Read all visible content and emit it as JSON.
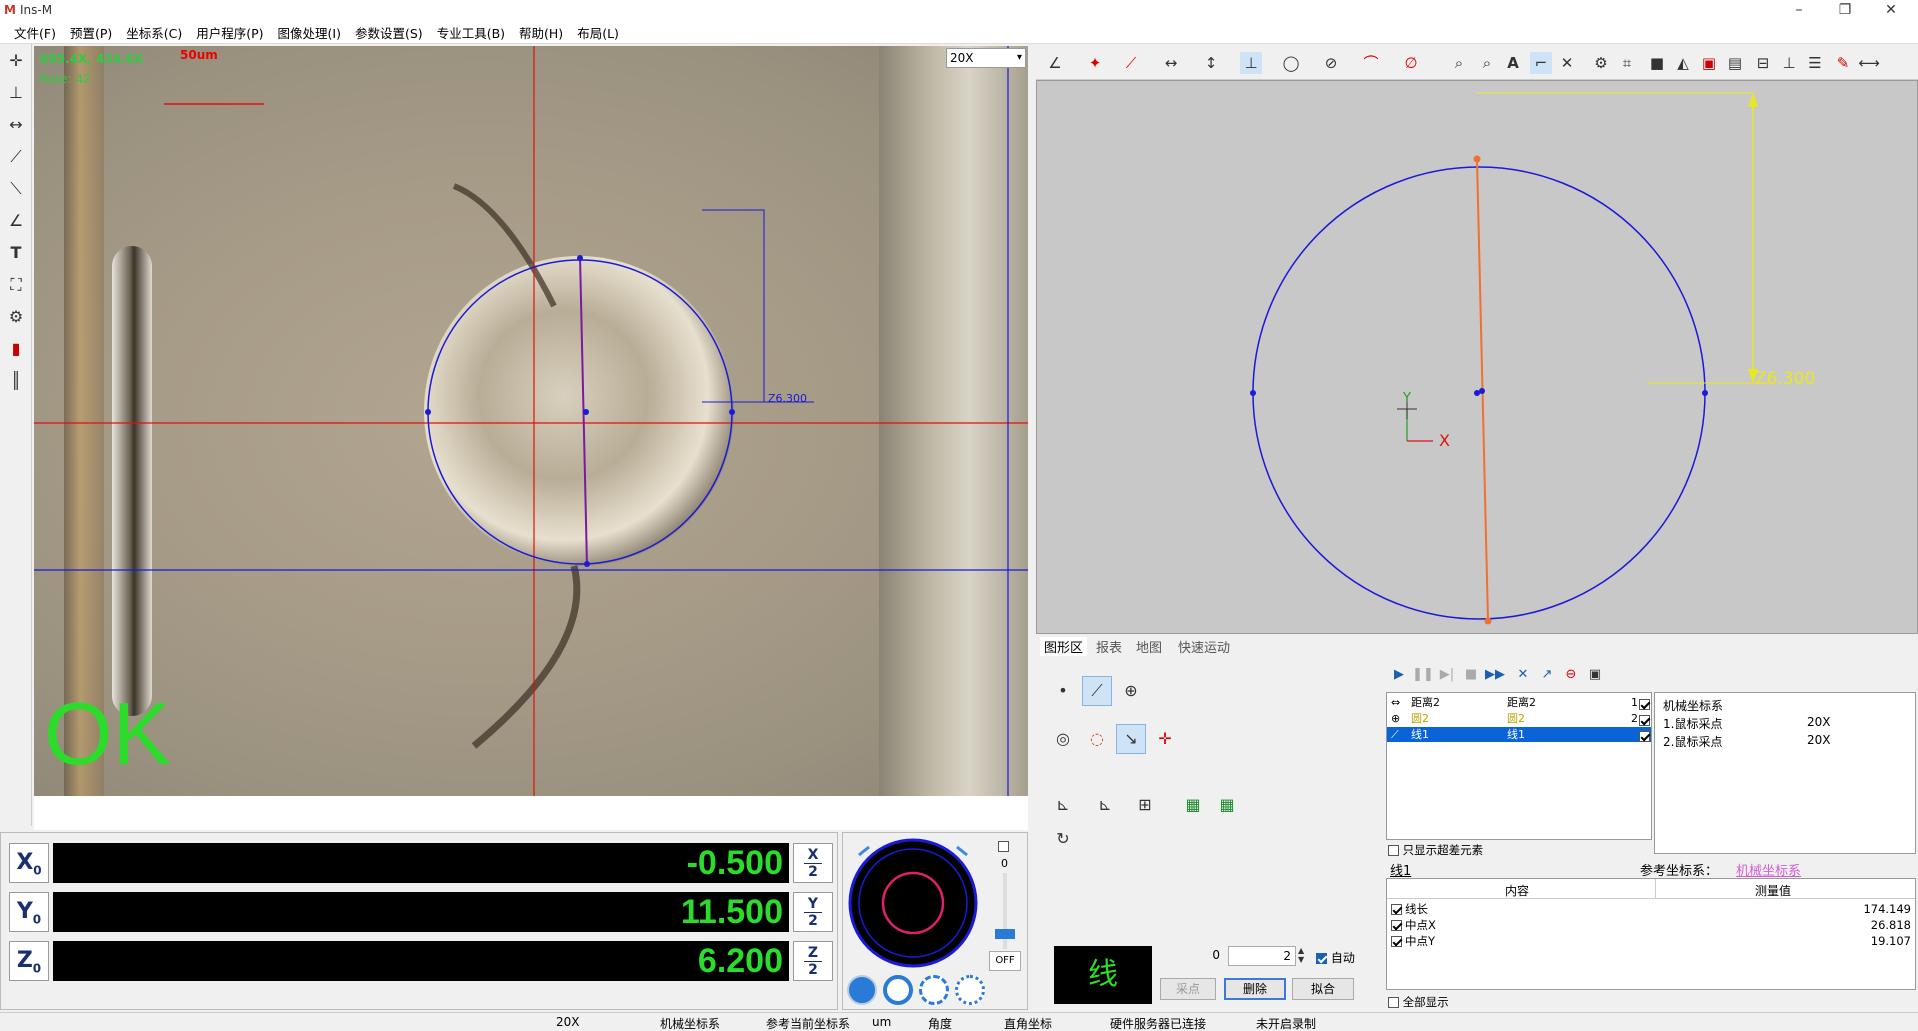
{
  "window": {
    "app_title": "Ins-M",
    "logo": "M",
    "min": "–",
    "max": "❐",
    "close": "✕"
  },
  "menu": [
    "文件(F)",
    "预置(P)",
    "坐标系(C)",
    "用户程序(P)",
    "图像处理(I)",
    "参数设置(S)",
    "专业工具(B)",
    "帮助(H)",
    "布局(L)"
  ],
  "camera": {
    "coord_readout": "695.4X, 434.6X",
    "rate_readout": "Rate: 42",
    "scale_label": "50um",
    "zoom_value": "20X",
    "overlay_dim_label": "Z6.300",
    "result_text": "OK"
  },
  "dro": {
    "x_label": "X",
    "x_sub": "0",
    "x_value": "-0.500",
    "y_label": "Y",
    "y_sub": "0",
    "y_value": "11.500",
    "z_label": "Z",
    "z_sub": "0",
    "z_value": "6.200",
    "x_half_top": "X",
    "y_half_top": "Y",
    "z_half_top": "Z",
    "half_bottom": "2"
  },
  "light": {
    "level": "0",
    "off_label": "OFF",
    "brightness_fraction": 0.15
  },
  "graph": {
    "dim_label": "Z6.300",
    "x_axis_label": "X",
    "y_axis_label": "Y"
  },
  "tabs": [
    "图形区",
    "报表",
    "地图",
    "快速运动"
  ],
  "element_panel": {
    "line_display": "线",
    "spin1_value": "0",
    "spin2_value": "2",
    "auto_label": "自动",
    "sample_button": "采点",
    "delete_button": "删除",
    "fit_button": "拟合"
  },
  "element_list": {
    "rows": [
      {
        "name": "距离2",
        "col2": "距离2",
        "num": "1"
      },
      {
        "name": "圆2",
        "col2": "圆2",
        "num": "2"
      },
      {
        "name": "线1",
        "col2": "线1",
        "num": ""
      }
    ],
    "only_out_of_tol": "只显示超差元素"
  },
  "info_box": {
    "title": "机械坐标系",
    "lines": [
      {
        "label": "1.鼠标采点",
        "value": "20X"
      },
      {
        "label": "2.鼠标采点",
        "value": "20X"
      }
    ]
  },
  "properties": {
    "element_name": "线1",
    "ref_label": "参考坐标系：",
    "ref_value": "机械坐标系",
    "col_content": "内容",
    "col_value": "测量值",
    "rows": [
      {
        "name": "线长",
        "value": "174.149"
      },
      {
        "name": "中点X",
        "value": "26.818"
      },
      {
        "name": "中点Y",
        "value": "19.107"
      }
    ],
    "show_all": "全部显示"
  },
  "status_bar": [
    "20X",
    "机械坐标系",
    "参考当前坐标系",
    "um",
    "角度",
    "直角坐标",
    "硬件服务器已连接",
    "未开启录制"
  ],
  "colors": {
    "dro_green": "#2bdc2b",
    "circle_blue": "#1a1ad8",
    "line_orange": "#f07030",
    "dim_yellow": "#e8e820",
    "crosshair_red": "#e01010"
  }
}
